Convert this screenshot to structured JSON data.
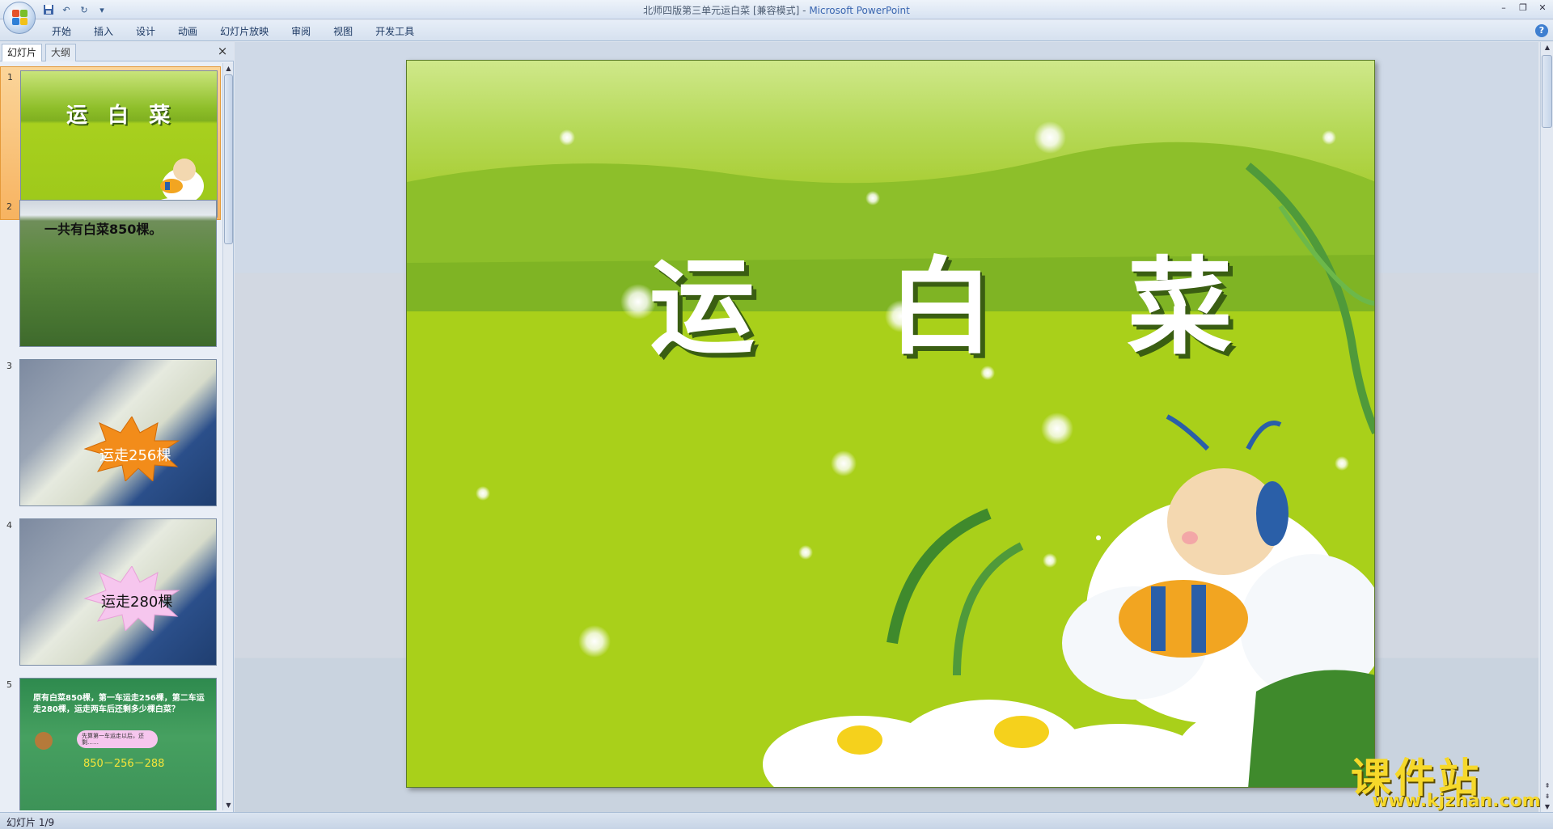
{
  "window": {
    "title": "北师四版第三单元运白菜 [兼容模式]",
    "title_sep": " - ",
    "app_name": "Microsoft PowerPoint"
  },
  "qat": {
    "save_icon": "save-icon",
    "undo_icon": "undo-icon",
    "redo_icon": "redo-icon",
    "customize_icon": "customize-qat-icon"
  },
  "ribbon": {
    "tabs": [
      "开始",
      "插入",
      "设计",
      "动画",
      "幻灯片放映",
      "审阅",
      "视图",
      "开发工具"
    ]
  },
  "panel": {
    "tab_slides": "幻灯片",
    "tab_outline": "大纲",
    "close_label": "×"
  },
  "thumbnails": [
    {
      "num": "1",
      "text": "运 白 菜"
    },
    {
      "num": "2",
      "text": "一共有白菜850棵。"
    },
    {
      "num": "3",
      "text": "运走256棵"
    },
    {
      "num": "4",
      "text": "运走280棵"
    },
    {
      "num": "5",
      "text": "原有白菜850棵，第一车运走256棵，第二车运走280棵，运走两车后还剩多少棵白菜？",
      "bubble": "先算第一车运走以后，还剩……",
      "formula": "850－256－288"
    }
  ],
  "slide": {
    "title": "运 白 菜"
  },
  "status": {
    "text": "幻灯片 1/9"
  },
  "watermark": {
    "big": "课件站",
    "small": "www.kjzhan.com"
  },
  "colors": {
    "accent": "#3a66b0",
    "slide_green": "#a6cc1e",
    "selected_thumb": "#f7b360"
  }
}
